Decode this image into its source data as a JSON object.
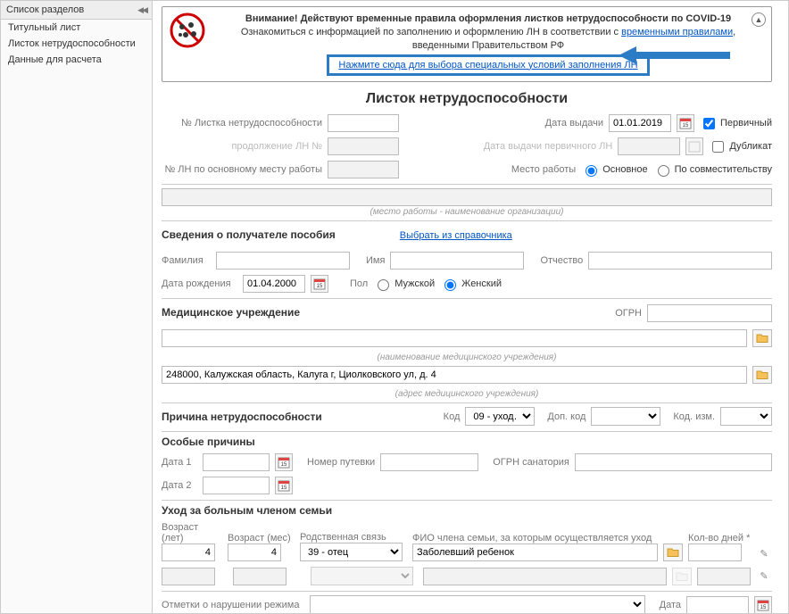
{
  "sidebar": {
    "title": "Список разделов",
    "items": [
      {
        "label": "Титульный лист"
      },
      {
        "label": "Листок нетрудоспособности"
      },
      {
        "label": "Данные для расчета"
      }
    ]
  },
  "covid": {
    "line1": "Внимание! Действуют временные правила оформления листков нетрудоспособности по COVID-19",
    "line2a": "Ознакомиться с информацией по заполнению и оформлению ЛН в соответствии с ",
    "link1": "временными правилами",
    "line2b": ", введенными Правительством РФ",
    "action": "Нажмите сюда для выбора специальных условий заполнения ЛН"
  },
  "title": "Листок нетрудоспособности",
  "ln": {
    "numLabel": "№ Листка нетрудоспособности",
    "numVal": "",
    "issueDateLabel": "Дата выдачи",
    "issueDate": "01.01.2019",
    "primary": "Первичный",
    "duplicate": "Дубликат",
    "contLabel": "продолжение ЛН №",
    "contVal": "",
    "contDateLabel": "Дата выдачи первичного ЛН",
    "contDate": "",
    "mainNumLabel": "№ ЛН по основному месту работы",
    "mainNumVal": "",
    "workplaceLabel": "Место работы",
    "workplaceMain": "Основное",
    "workplaceSec": "По совместительству",
    "orgNote": "(место работы - наименование организации)"
  },
  "recipient": {
    "heading": "Сведения о получателе пособия",
    "refLink": "Выбрать из справочника",
    "surnameLabel": "Фамилия",
    "surname": "",
    "nameLabel": "Имя",
    "name": "",
    "patronymLabel": "Отчество",
    "patronym": "",
    "dobLabel": "Дата рождения",
    "dob": "01.04.2000",
    "sexLabel": "Пол",
    "male": "Мужской",
    "female": "Женский"
  },
  "med": {
    "heading": "Медицинское учреждение",
    "ogrnLabel": "ОГРН",
    "ogrn": "",
    "nameNote": "(наименование медицинского учреждения)",
    "address": "248000, Калужская область, Калуга г, Циолковского ул, д. 4",
    "addrNote": "(адрес медицинского учреждения)"
  },
  "cause": {
    "heading": "Причина нетрудоспособности",
    "codeLabel": "Код",
    "code": "09 - уход…",
    "addCodeLabel": "Доп. код",
    "addCode": "",
    "modCodeLabel": "Код. изм.",
    "modCode": ""
  },
  "special": {
    "heading": "Особые причины",
    "date1Label": "Дата 1",
    "date1": "",
    "ticketLabel": "Номер путевки",
    "ticket": "",
    "sanOgrnLabel": "ОГРН санатория",
    "sanOgrn": "",
    "date2Label": "Дата 2",
    "date2": ""
  },
  "care": {
    "heading": "Уход за больным членом семьи",
    "ageYLabel": "Возраст (лет)",
    "ageY": "4",
    "ageMLabel": "Возраст (мес)",
    "ageM": "4",
    "relLabel": "Родственная связь",
    "rel": "39 - отец",
    "fioLabel": "ФИО члена семьи, за которым осуществляется уход",
    "fio": "Заболевший ребенок",
    "daysLabel": "Кол-во дней *",
    "days": ""
  },
  "violation": {
    "heading": "Отметки о нарушении режима",
    "dateLabel": "Дата",
    "date": ""
  },
  "icons": {
    "cal": "📅",
    "folder": "📂",
    "pencil": "✎"
  }
}
